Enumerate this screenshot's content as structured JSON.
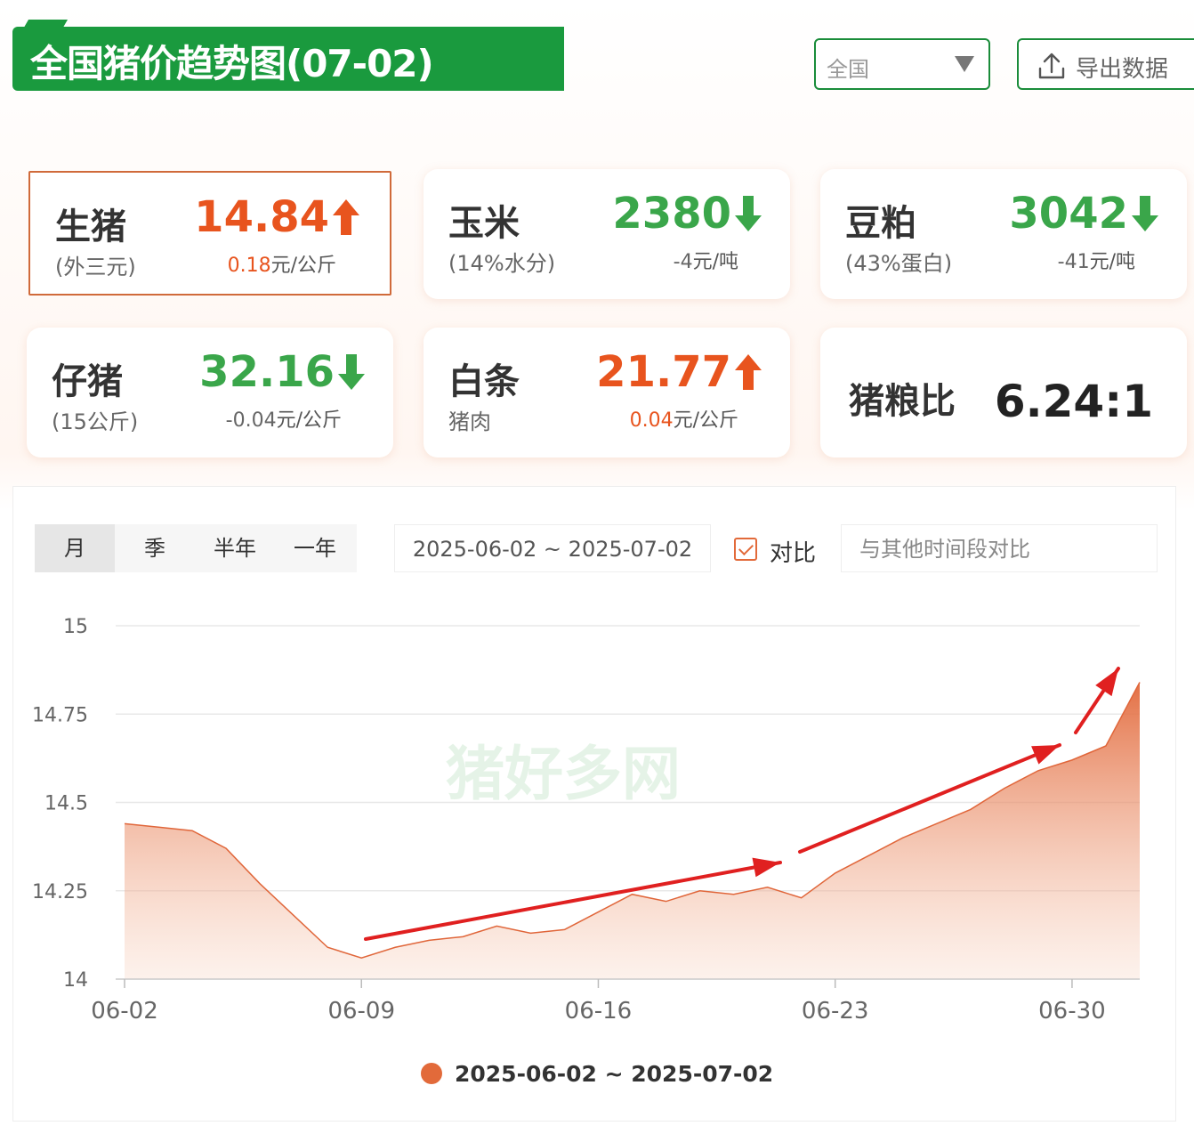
{
  "header": {
    "title": "全国猪价趋势图(07-02)",
    "region_select": "全国",
    "export_label": "导出数据"
  },
  "cards": [
    {
      "name": "生猪",
      "sub": "(外三元)",
      "price": "14.84",
      "change": "0.18",
      "unit": "元/公斤",
      "trend": "up"
    },
    {
      "name": "玉米",
      "sub": "(14%水分)",
      "price": "2380",
      "change": "-4",
      "unit": "元/吨",
      "trend": "down"
    },
    {
      "name": "豆粕",
      "sub": "(43%蛋白)",
      "price": "3042",
      "change": "-41",
      "unit": "元/吨",
      "trend": "down"
    },
    {
      "name": "仔猪",
      "sub": "(15公斤)",
      "price": "32.16",
      "change": "-0.04",
      "unit": "元/公斤",
      "trend": "down"
    },
    {
      "name": "白条",
      "sub": "猪肉",
      "price": "21.77",
      "change": "0.04",
      "unit": "元/公斤",
      "trend": "up"
    }
  ],
  "ratio": {
    "name": "猪粮比",
    "value": "6.24:1"
  },
  "controls": {
    "period_tabs": [
      "月",
      "季",
      "半年",
      "一年"
    ],
    "active_tab": "月",
    "date_range": "2025-06-02 ~ 2025-07-02",
    "compare_label": "对比",
    "compare_placeholder": "与其他时间段对比"
  },
  "colors": {
    "brand_green": "#1a9a3e",
    "up_orange": "#e8541e",
    "down_green": "#3aa64a",
    "series_orange": "#e26a3a",
    "annotation_red": "#e02020"
  },
  "watermark": "猪好多网",
  "chart_data": {
    "type": "area",
    "x": [
      "06-02",
      "06-03",
      "06-04",
      "06-05",
      "06-06",
      "06-07",
      "06-08",
      "06-09",
      "06-10",
      "06-11",
      "06-12",
      "06-13",
      "06-14",
      "06-15",
      "06-16",
      "06-17",
      "06-18",
      "06-19",
      "06-20",
      "06-21",
      "06-22",
      "06-23",
      "06-24",
      "06-25",
      "06-26",
      "06-27",
      "06-28",
      "06-29",
      "06-30",
      "07-01",
      "07-02"
    ],
    "series": [
      {
        "name": "2025-06-02 ~ 2025-07-02",
        "values": [
          14.44,
          14.43,
          14.42,
          14.37,
          14.27,
          14.18,
          14.09,
          14.06,
          14.09,
          14.11,
          14.12,
          14.15,
          14.13,
          14.14,
          14.19,
          14.24,
          14.22,
          14.25,
          14.24,
          14.26,
          14.23,
          14.3,
          14.35,
          14.4,
          14.44,
          14.48,
          14.54,
          14.59,
          14.62,
          14.66,
          14.84
        ]
      }
    ],
    "x_ticks": [
      "06-02",
      "06-09",
      "06-16",
      "06-23",
      "06-30"
    ],
    "y_ticks": [
      "15",
      "14.75",
      "14.5",
      "14.25",
      "14"
    ],
    "ylim": [
      14,
      15
    ],
    "grid": true,
    "legend": "bottom-center"
  }
}
